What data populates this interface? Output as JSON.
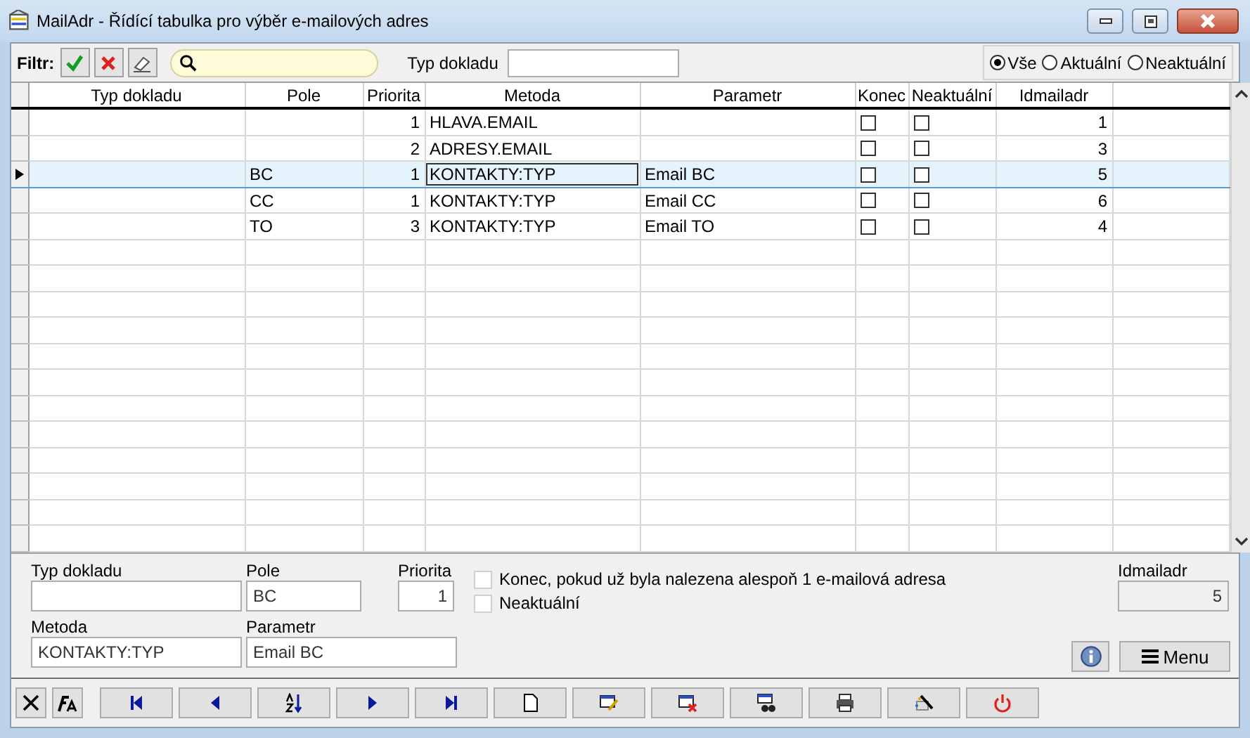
{
  "window": {
    "title": "MailAdr - Řídící tabulka pro výběr e-mailových adres"
  },
  "filter_bar": {
    "label": "Filtr:",
    "typ_dokladu_label": "Typ dokladu",
    "options": [
      {
        "label": "Vše",
        "selected": true
      },
      {
        "label": "Aktuální",
        "selected": false
      },
      {
        "label": "Neaktuální",
        "selected": false
      }
    ]
  },
  "table": {
    "columns": [
      "Typ dokladu",
      "Pole",
      "Priorita",
      "Metoda",
      "Parametr",
      "Konec",
      "Neaktuální",
      "Idmailadr"
    ],
    "rows": [
      {
        "priorita": "1",
        "metoda": "HLAVA.EMAIL",
        "konec": false,
        "neaktualni": false,
        "idmailadr": "1",
        "selected": false,
        "metoda_focused": false
      },
      {
        "priorita": "2",
        "metoda": "ADRESY.EMAIL",
        "konec": false,
        "neaktualni": false,
        "idmailadr": "3",
        "selected": false,
        "metoda_focused": false
      },
      {
        "pole": "BC",
        "priorita": "1",
        "metoda": "KONTAKTY:TYP",
        "parametr": "Email BC",
        "konec": false,
        "neaktualni": false,
        "idmailadr": "5",
        "selected": true,
        "metoda_focused": true
      },
      {
        "pole": "CC",
        "priorita": "1",
        "metoda": "KONTAKTY:TYP",
        "parametr": "Email CC",
        "konec": false,
        "neaktualni": false,
        "idmailadr": "6",
        "selected": false,
        "metoda_focused": false
      },
      {
        "pole": "TO",
        "priorita": "3",
        "metoda": "KONTAKTY:TYP",
        "parametr": "Email TO",
        "konec": false,
        "neaktualni": false,
        "idmailadr": "4",
        "selected": false,
        "metoda_focused": false
      }
    ]
  },
  "detail": {
    "typ_dokladu_label": "Typ dokladu",
    "pole_label": "Pole",
    "pole_value": "BC",
    "priorita_label": "Priorita",
    "priorita_value": "1",
    "metoda_label": "Metoda",
    "metoda_value": "KONTAKTY:TYP",
    "parametr_label": "Parametr",
    "parametr_value": "Email BC",
    "checkboxes": [
      {
        "label": "Konec, pokud už byla nalezena alespoň 1 e-mailová adresa",
        "checked": false
      },
      {
        "label": "Neaktuální",
        "checked": false
      }
    ],
    "idmailadr_label": "Idmailadr",
    "idmailadr_value": "5",
    "menu_button": "Menu"
  }
}
